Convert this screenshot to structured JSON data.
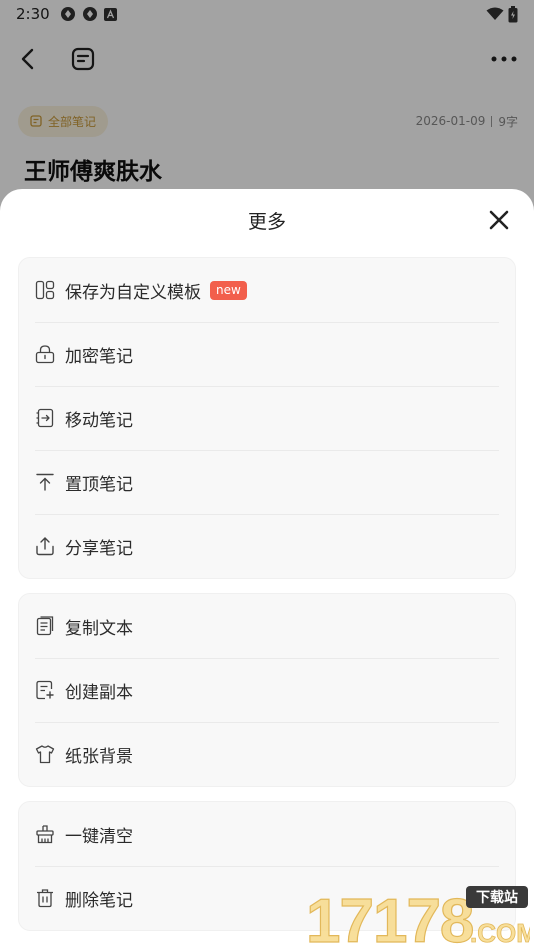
{
  "status_bar": {
    "time": "2:30"
  },
  "note": {
    "tag": "全部笔记",
    "date": "2026-01-09",
    "word_count": "9字",
    "title": "王师傅爽肤水"
  },
  "sheet": {
    "title": "更多",
    "groups": [
      {
        "items": [
          {
            "label": "保存为自定义模板",
            "icon": "template-icon",
            "badge": "new"
          },
          {
            "label": "加密笔记",
            "icon": "lock-icon"
          },
          {
            "label": "移动笔记",
            "icon": "move-icon"
          },
          {
            "label": "置顶笔记",
            "icon": "pin-top-icon"
          },
          {
            "label": "分享笔记",
            "icon": "share-icon"
          }
        ]
      },
      {
        "items": [
          {
            "label": "复制文本",
            "icon": "copy-text-icon"
          },
          {
            "label": "创建副本",
            "icon": "duplicate-icon"
          },
          {
            "label": "纸张背景",
            "icon": "paper-background-icon"
          }
        ]
      },
      {
        "items": [
          {
            "label": "一键清空",
            "icon": "clear-icon"
          },
          {
            "label": "删除笔记",
            "icon": "trash-icon"
          }
        ]
      }
    ]
  },
  "watermark": {
    "number": "17178",
    "tag": "下载站",
    "domain": ".COM"
  },
  "colors": {
    "badge": "#f25f4c",
    "tag_bg": "#fbf3df",
    "tag_text": "#c89a3a",
    "watermark": "#f7d98a"
  }
}
